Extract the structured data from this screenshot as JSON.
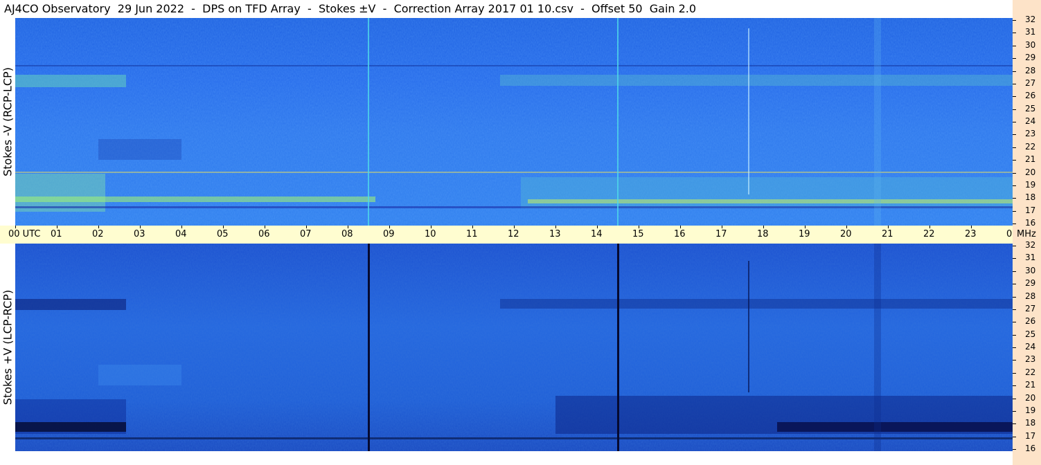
{
  "title": "AJ4CO Observatory  29 Jun 2022  -  DPS on TFD Array  -  Stokes ±V  -  Correction Array 2017 01 10.csv  -  Offset 50  Gain 2.0",
  "top_panel": {
    "label": "Stokes -V (RCP-LCP)"
  },
  "bottom_panel": {
    "label": "Stokes +V (LCP-RCP)"
  },
  "time_axis": {
    "labels": [
      "00  UTC",
      "01",
      "02",
      "03",
      "04",
      "05",
      "06",
      "07",
      "08",
      "09",
      "10",
      "11",
      "12",
      "13",
      "14",
      "15",
      "16",
      "17",
      "18",
      "19",
      "20",
      "21",
      "22",
      "23",
      "00"
    ],
    "unit_label": "MHz"
  },
  "freq_axis": {
    "labels": [
      "32",
      "31",
      "30",
      "29",
      "28",
      "27",
      "26",
      "25",
      "24",
      "23",
      "22",
      "21",
      "20",
      "19",
      "18",
      "17",
      "16"
    ]
  },
  "colors": {
    "background_blue": "#1f63e6",
    "time_bar": "#fffdd0",
    "freq_axis": "#fde3c8"
  }
}
